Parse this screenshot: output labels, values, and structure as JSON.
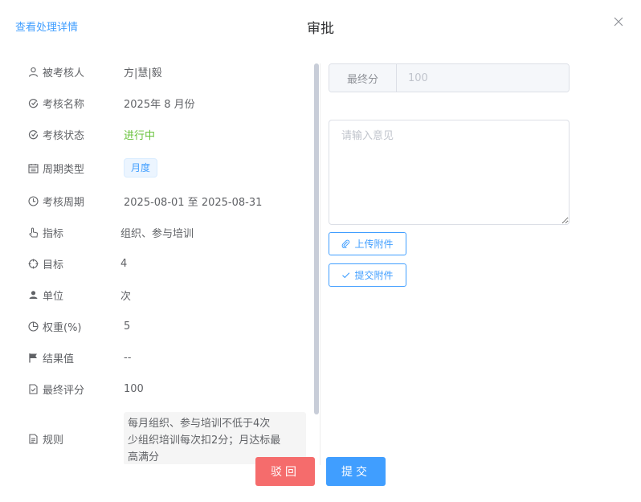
{
  "header": {
    "details_link": "查看处理详情",
    "title": "审批"
  },
  "fields": [
    {
      "icon": "user-icon",
      "label": "被考核人",
      "value": "方|慧|毅"
    },
    {
      "icon": "assessment-icon",
      "label": "考核名称",
      "value": "2025年 8 月份"
    },
    {
      "icon": "status-icon",
      "label": "考核状态",
      "value": "进行中"
    },
    {
      "icon": "calendar-icon",
      "label": "周期类型",
      "value": "月度"
    },
    {
      "icon": "clock-icon",
      "label": "考核周期",
      "value": "2025-08-01 至 2025-08-31"
    },
    {
      "icon": "pointer-hand-icon",
      "label": "指标",
      "value": "组织、参与培训"
    },
    {
      "icon": "target-icon",
      "label": "目标",
      "value": "4"
    },
    {
      "icon": "person-icon",
      "label": "单位",
      "value": "次"
    },
    {
      "icon": "pie-chart-icon",
      "label": "权重(%)",
      "value": "5"
    },
    {
      "icon": "flag-icon",
      "label": "结果值",
      "value": "--"
    },
    {
      "icon": "document-check-icon",
      "label": "最终评分",
      "value": "100"
    },
    {
      "icon": "document-icon",
      "label": "规则",
      "value": "每月组织、参与培训不低于4次少组织培训每次扣2分；月达标最高满分"
    }
  ],
  "rule_lines": [
    "每月组织、参与培训不低于4次",
    "少组织培训每次扣2分；月达标最",
    "高满分"
  ],
  "form": {
    "final_score_label": "最终分",
    "final_score_value": "100",
    "opinion_placeholder": "请输入意见",
    "upload_button": "上传附件",
    "submit_attachment_button": "提交附件"
  },
  "footer": {
    "reject_button": "驳回",
    "submit_button": "提交"
  },
  "colors": {
    "primary": "#409eff",
    "danger": "#f56c6c",
    "success": "#67c23a"
  }
}
